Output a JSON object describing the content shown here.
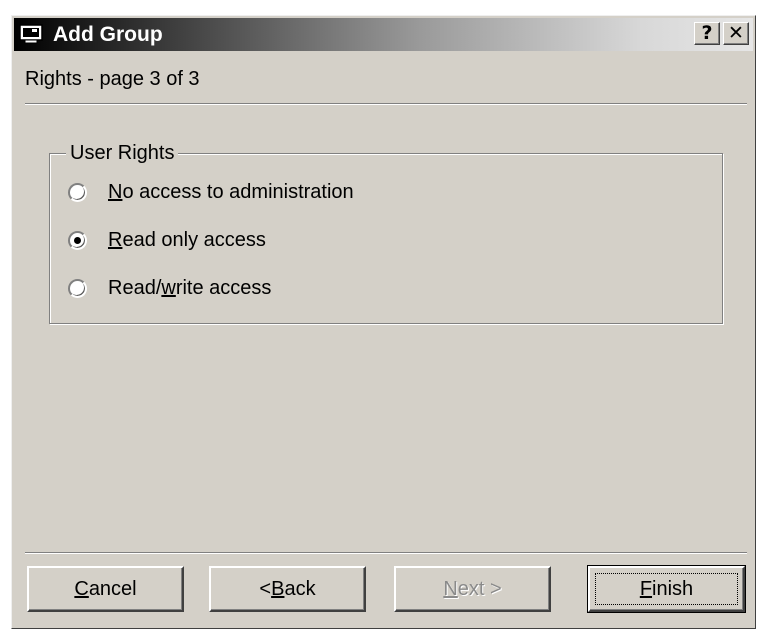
{
  "window": {
    "title": "Add Group",
    "help_label": "?",
    "close_label": "✕"
  },
  "page": {
    "heading": "Rights - page 3 of 3"
  },
  "user_rights": {
    "legend": "User Rights",
    "selected_index": 1,
    "options": [
      {
        "accel": "N",
        "rest": "o access to administration",
        "pre": ""
      },
      {
        "accel": "R",
        "rest": "ead only access",
        "pre": ""
      },
      {
        "accel": "w",
        "rest": "rite access",
        "pre": "Read/"
      }
    ]
  },
  "buttons": {
    "cancel": {
      "accel": "C",
      "rest": "ancel",
      "pre": ""
    },
    "back": {
      "accel": "B",
      "rest": "ack",
      "pre": "< "
    },
    "next": {
      "accel": "N",
      "rest": "ext >",
      "pre": "",
      "enabled": false
    },
    "finish": {
      "accel": "F",
      "rest": "inish",
      "pre": ""
    }
  },
  "colors": {
    "face": "#d4d0c8",
    "title_gradient_start": "#000000",
    "title_gradient_end": "#e6e6e6",
    "disabled_text": "#8a8a8a"
  },
  "icons": {
    "window": "window-icon",
    "help": "question-mark-icon",
    "close": "close-x-icon"
  }
}
